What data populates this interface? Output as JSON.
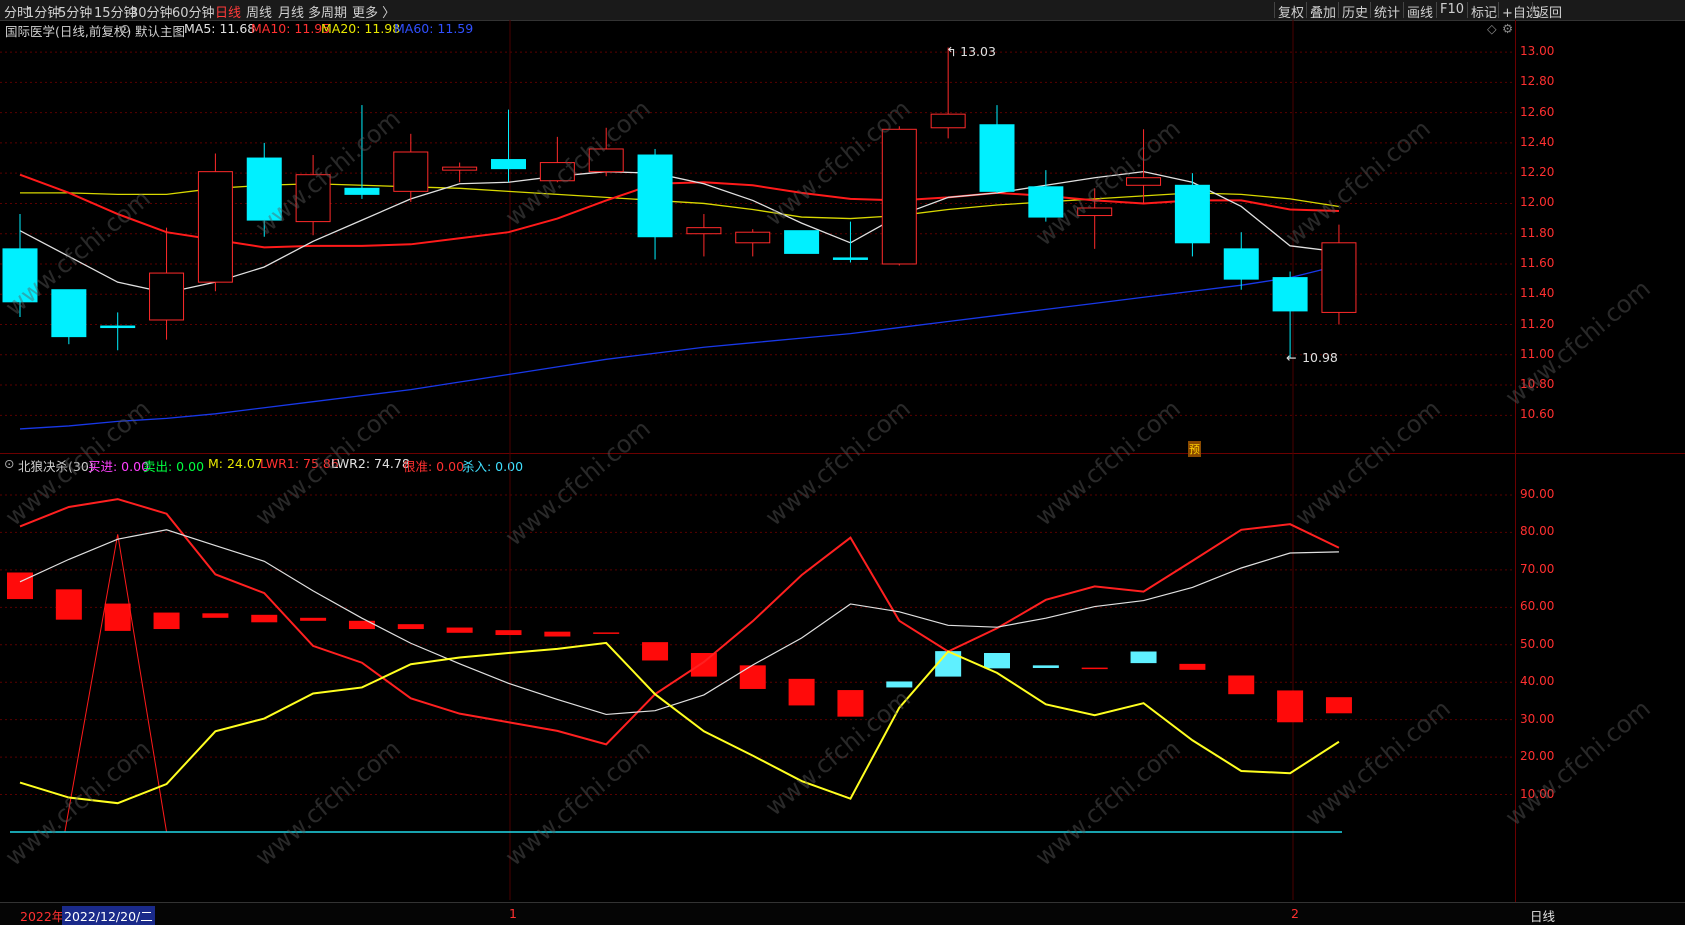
{
  "toolbar": {
    "left": [
      "分时",
      "1分钟",
      "5分钟",
      "15分钟",
      "30分钟",
      "60分钟",
      "日线",
      "周线",
      "月线",
      "多周期",
      "更多 〉"
    ],
    "active_index": 6,
    "right": [
      "复权",
      "叠加",
      "历史",
      "统计",
      "画线",
      "F10",
      "标记",
      "+自选",
      "返回"
    ]
  },
  "main": {
    "title": "国际医学(日线,前复权)",
    "template": "默认主图",
    "ma": [
      {
        "label": "MA5: 11.68",
        "color": "#e0e0e0"
      },
      {
        "label": "MA10: 11.95",
        "color": "#ff3030"
      },
      {
        "label": "MA20: 11.98",
        "color": "#e8e800"
      },
      {
        "label": "MA60: 11.59",
        "color": "#3050ff"
      }
    ],
    "high_label": "13.03",
    "low_label": "10.98",
    "forecast_badge": "预",
    "price_ticks": [
      "13.00",
      "12.80",
      "12.60",
      "12.40",
      "12.20",
      "12.00",
      "11.80",
      "11.60",
      "11.40",
      "11.20",
      "11.00",
      "10.80",
      "10.60"
    ]
  },
  "indicator": {
    "title": "北狼决杀(30)",
    "values": [
      {
        "label": "买进: 0.00",
        "color": "#ff40ff"
      },
      {
        "label": "卖出: 0.00",
        "color": "#00ff40"
      },
      {
        "label": "M: 24.07",
        "color": "#e8e800"
      },
      {
        "label": "LWR1: 75.86",
        "color": "#ff3030"
      },
      {
        "label": "LWR2: 74.78",
        "color": "#e0e0e0"
      },
      {
        "label": "很准: 0.00",
        "color": "#ff3030"
      },
      {
        "label": "杀入: 0.00",
        "color": "#40e0ff"
      }
    ],
    "ticks": [
      "90.00",
      "80.00",
      "70.00",
      "60.00",
      "50.00",
      "40.00",
      "30.00",
      "20.00",
      "10.00"
    ]
  },
  "bottom": {
    "year_label": "2022年",
    "date_label": "2022/12/20/二",
    "marks": [
      "1",
      "2"
    ],
    "period_label": "日线"
  },
  "watermark": "www.cfchi.com",
  "chart_data": [
    {
      "type": "candlestick",
      "title": "国际医学(日线,前复权)",
      "ohlc": [
        {
          "o": 11.7,
          "h": 11.93,
          "l": 11.25,
          "c": 11.35
        },
        {
          "o": 11.43,
          "h": 11.43,
          "l": 11.07,
          "c": 11.12
        },
        {
          "o": 11.19,
          "h": 11.28,
          "l": 11.03,
          "c": 11.18
        },
        {
          "o": 11.23,
          "h": 11.84,
          "l": 11.1,
          "c": 11.54
        },
        {
          "o": 11.48,
          "h": 12.33,
          "l": 11.42,
          "c": 12.21
        },
        {
          "o": 12.3,
          "h": 12.4,
          "l": 11.78,
          "c": 11.89
        },
        {
          "o": 11.88,
          "h": 12.32,
          "l": 11.79,
          "c": 12.19
        },
        {
          "o": 12.1,
          "h": 12.65,
          "l": 12.03,
          "c": 12.06
        },
        {
          "o": 12.08,
          "h": 12.46,
          "l": 12.01,
          "c": 12.34
        },
        {
          "o": 12.22,
          "h": 12.27,
          "l": 12.14,
          "c": 12.24
        },
        {
          "o": 12.29,
          "h": 12.62,
          "l": 12.14,
          "c": 12.23
        },
        {
          "o": 12.15,
          "h": 12.44,
          "l": 12.14,
          "c": 12.27
        },
        {
          "o": 12.21,
          "h": 12.5,
          "l": 12.18,
          "c": 12.36
        },
        {
          "o": 12.32,
          "h": 12.36,
          "l": 11.63,
          "c": 11.78
        },
        {
          "o": 11.8,
          "h": 11.93,
          "l": 11.65,
          "c": 11.84
        },
        {
          "o": 11.74,
          "h": 11.83,
          "l": 11.65,
          "c": 11.81
        },
        {
          "o": 11.82,
          "h": 11.82,
          "l": 11.67,
          "c": 11.67
        },
        {
          "o": 11.64,
          "h": 11.88,
          "l": 11.61,
          "c": 11.63
        },
        {
          "o": 11.6,
          "h": 12.51,
          "l": 11.59,
          "c": 12.49
        },
        {
          "o": 12.5,
          "h": 13.03,
          "l": 12.43,
          "c": 12.59
        },
        {
          "o": 12.52,
          "h": 12.65,
          "l": 12.07,
          "c": 12.08
        },
        {
          "o": 12.11,
          "h": 12.22,
          "l": 11.88,
          "c": 11.91
        },
        {
          "o": 11.92,
          "h": 12.1,
          "l": 11.7,
          "c": 11.97
        },
        {
          "o": 12.12,
          "h": 12.49,
          "l": 12.0,
          "c": 12.17
        },
        {
          "o": 12.12,
          "h": 12.2,
          "l": 11.65,
          "c": 11.74
        },
        {
          "o": 11.7,
          "h": 11.81,
          "l": 11.43,
          "c": 11.5
        },
        {
          "o": 11.51,
          "h": 11.55,
          "l": 10.98,
          "c": 11.29
        },
        {
          "o": 11.28,
          "h": 11.86,
          "l": 11.2,
          "c": 11.74
        }
      ],
      "ma5": [
        11.82,
        11.65,
        11.48,
        11.41,
        11.48,
        11.58,
        11.75,
        11.89,
        12.03,
        12.13,
        12.14,
        12.18,
        12.21,
        12.2,
        12.13,
        12.02,
        11.87,
        11.74,
        11.92,
        12.04,
        12.07,
        12.12,
        12.17,
        12.21,
        12.14,
        11.98,
        11.72,
        11.68
      ],
      "ma10": [
        12.19,
        12.07,
        11.93,
        11.81,
        11.76,
        11.71,
        11.72,
        11.72,
        11.73,
        11.77,
        11.81,
        11.9,
        12.02,
        12.13,
        12.14,
        12.12,
        12.07,
        12.03,
        12.02,
        12.04,
        12.07,
        12.05,
        12.02,
        12.0,
        12.02,
        12.02,
        11.96,
        11.95
      ],
      "ma20": [
        12.07,
        12.07,
        12.06,
        12.06,
        12.1,
        12.12,
        12.13,
        12.12,
        12.11,
        12.1,
        12.08,
        12.06,
        12.04,
        12.02,
        12.0,
        11.96,
        11.91,
        11.9,
        11.92,
        11.96,
        11.99,
        12.01,
        12.03,
        12.05,
        12.07,
        12.06,
        12.03,
        11.98
      ],
      "ma60": [
        10.51,
        10.53,
        10.56,
        10.58,
        10.61,
        10.65,
        10.69,
        10.73,
        10.77,
        10.82,
        10.87,
        10.92,
        10.97,
        11.01,
        11.05,
        11.08,
        11.11,
        11.14,
        11.18,
        11.22,
        11.26,
        11.3,
        11.34,
        11.38,
        11.42,
        11.46,
        11.51,
        11.59
      ],
      "ylim": [
        10.47,
        13.08
      ]
    },
    {
      "type": "line",
      "title": "北狼决杀(30)",
      "series": [
        {
          "name": "LWR1",
          "color": "#ff2020",
          "values": [
            81.6,
            86.8,
            88.9,
            85.0,
            68.8,
            63.8,
            49.7,
            45.2,
            35.7,
            31.6,
            29.3,
            27.0,
            23.4,
            36.8,
            45.4,
            56.3,
            68.6,
            78.6,
            56.4,
            48.2,
            54.4,
            62.0,
            65.6,
            64.2,
            72.4,
            80.7,
            82.2,
            75.9
          ]
        },
        {
          "name": "LWR2",
          "color": "#e0e0e0",
          "values": [
            66.8,
            72.8,
            78.2,
            80.7,
            76.5,
            72.3,
            64.4,
            57.1,
            50.4,
            44.9,
            39.7,
            35.4,
            31.4,
            32.4,
            36.6,
            44.6,
            51.8,
            60.9,
            58.8,
            55.2,
            54.7,
            57.1,
            60.2,
            61.8,
            65.3,
            70.5,
            74.5,
            74.8
          ]
        },
        {
          "name": "M",
          "color": "#ffff20",
          "values": [
            13.2,
            9.2,
            7.7,
            12.8,
            26.9,
            30.3,
            37.0,
            38.6,
            44.8,
            46.6,
            47.8,
            48.9,
            50.5,
            36.8,
            26.9,
            20.4,
            13.6,
            8.9,
            33.2,
            48.2,
            42.5,
            34.1,
            31.2,
            34.4,
            24.5,
            16.3,
            15.7,
            24.1
          ]
        }
      ],
      "bars": [
        {
          "t": 69.3,
          "b": 62.2,
          "up": false
        },
        {
          "t": 64.8,
          "b": 56.7,
          "up": false
        },
        {
          "t": 61.0,
          "b": 53.7,
          "up": false
        },
        {
          "t": 58.6,
          "b": 54.2,
          "up": false
        },
        {
          "t": 58.4,
          "b": 57.2,
          "up": false
        },
        {
          "t": 58.0,
          "b": 56.0,
          "up": false
        },
        {
          "t": 57.2,
          "b": 56.4,
          "up": false
        },
        {
          "t": 56.4,
          "b": 54.2,
          "up": false
        },
        {
          "t": 55.5,
          "b": 54.2,
          "up": false
        },
        {
          "t": 54.6,
          "b": 53.2,
          "up": false
        },
        {
          "t": 53.9,
          "b": 52.6,
          "up": false
        },
        {
          "t": 53.5,
          "b": 52.2,
          "up": false
        },
        {
          "t": 53.3,
          "b": 53.1,
          "up": false
        },
        {
          "t": 50.7,
          "b": 45.8,
          "up": false
        },
        {
          "t": 47.8,
          "b": 41.5,
          "up": false
        },
        {
          "t": 44.5,
          "b": 38.2,
          "up": false
        },
        {
          "t": 40.9,
          "b": 33.8,
          "up": false
        },
        {
          "t": 37.9,
          "b": 30.8,
          "up": false
        },
        {
          "t": 40.2,
          "b": 38.6,
          "up": true
        },
        {
          "t": 48.3,
          "b": 41.5,
          "up": true
        },
        {
          "t": 47.8,
          "b": 43.7,
          "up": true
        },
        {
          "t": 44.5,
          "b": 43.8,
          "up": true
        },
        {
          "t": 43.9,
          "b": 43.7,
          "up": false
        },
        {
          "t": 48.2,
          "b": 45.1,
          "up": true
        },
        {
          "t": 44.9,
          "b": 43.3,
          "up": false
        },
        {
          "t": 41.8,
          "b": 36.8,
          "up": false
        },
        {
          "t": 37.8,
          "b": 29.3,
          "up": false
        },
        {
          "t": 36.0,
          "b": 31.7,
          "up": false
        }
      ],
      "spike": {
        "from_index": 1,
        "peak_index": 2,
        "to_index": 3,
        "peak": 79.5,
        "base": 0
      },
      "ylim": [
        0,
        94
      ]
    }
  ]
}
